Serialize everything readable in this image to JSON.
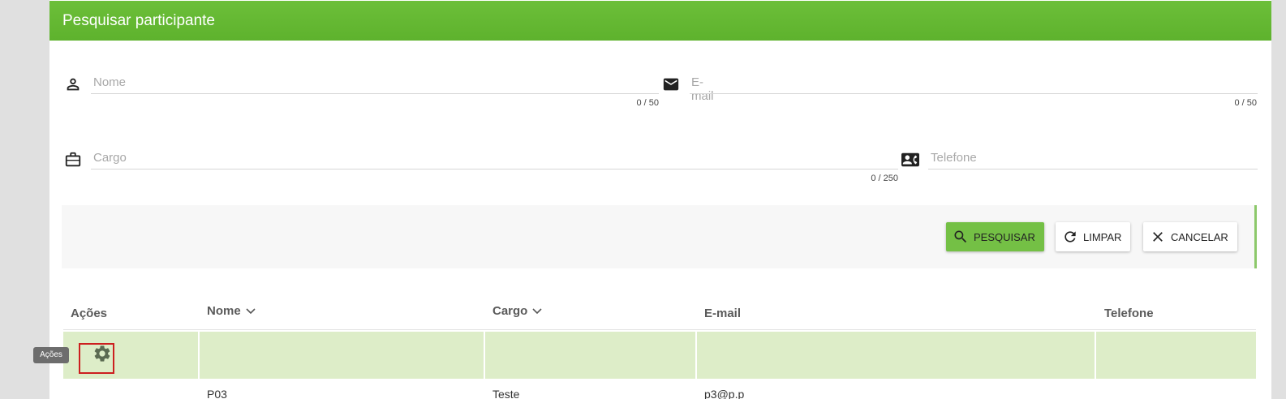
{
  "dialog": {
    "title": "Pesquisar participante"
  },
  "fields": {
    "nome": {
      "placeholder": "Nome",
      "counter": "0 / 50",
      "icon": "person-icon"
    },
    "email": {
      "placeholder": "E-mail",
      "counter": "0 / 50",
      "icon": "mail-icon"
    },
    "cargo": {
      "placeholder": "Cargo",
      "counter": "0 / 250",
      "icon": "briefcase-icon"
    },
    "telefone": {
      "placeholder": "Telefone",
      "icon": "contact-phone-icon"
    }
  },
  "buttons": {
    "search": "PESQUISAR",
    "clear": "LIMPAR",
    "cancel": "CANCELAR"
  },
  "table": {
    "headers": [
      "Ações",
      "Nome",
      "Cargo",
      "E-mail",
      "Telefone"
    ],
    "rows": [
      {
        "nome": "",
        "cargo": "",
        "email": "",
        "telefone": "",
        "action_icon": "gear-icon"
      },
      {
        "nome": "P03",
        "cargo": "Teste",
        "email": "p3@p.p",
        "telefone": ""
      }
    ]
  },
  "tooltip": "Ações",
  "colors": {
    "header": "#64b832",
    "accent": "#74c045",
    "row_selected": "#ddedc8"
  }
}
